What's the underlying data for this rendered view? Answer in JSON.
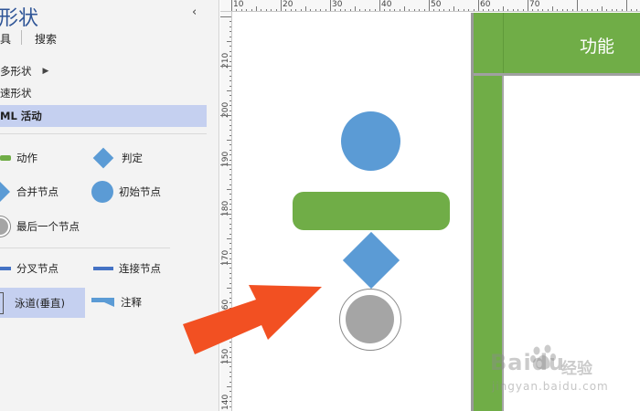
{
  "panel": {
    "title": "形状",
    "tabs": [
      "具",
      "搜索"
    ],
    "stencils": [
      {
        "label": "多形状",
        "has_submenu": true
      },
      {
        "label": "速形状",
        "has_submenu": false
      },
      {
        "label": "ML 活动",
        "active": true
      }
    ],
    "shapes": [
      {
        "label": "动作",
        "icon": "action-bar-icon",
        "color": "#70ad47"
      },
      {
        "label": "判定",
        "icon": "diamond-icon",
        "color": "#5b9bd5"
      },
      {
        "label": "合并节点",
        "icon": "merge-diamond-icon",
        "color": "#5b9bd5"
      },
      {
        "label": "初始节点",
        "icon": "circle-icon",
        "color": "#5b9bd5"
      },
      {
        "label": "最后一个节点",
        "icon": "final-node-icon",
        "color": "#a5a5a5"
      },
      {
        "label": "分叉节点",
        "icon": "fork-bar-icon",
        "color": "#4472c4"
      },
      {
        "label": "连接节点",
        "icon": "join-bar-icon",
        "color": "#4472c4"
      },
      {
        "label": "泳道(垂直)",
        "icon": "swimlane-icon",
        "selected": true
      },
      {
        "label": "注释",
        "icon": "note-icon",
        "color": "#5b9bd5"
      }
    ]
  },
  "rulers": {
    "top": [
      "10",
      "20",
      "30",
      "40",
      "50",
      "60",
      "70"
    ],
    "left": [
      "210",
      "200",
      "190",
      "180",
      "170",
      "160",
      "150",
      "140"
    ]
  },
  "swimlane": {
    "title": "功能",
    "color": "#70ad47"
  },
  "watermark": {
    "logo": "Baidu",
    "cn": "经验",
    "url": "jingyan.baidu.com"
  },
  "colors": {
    "accent_green": "#70ad47",
    "accent_blue": "#5b9bd5",
    "arrow": "#f25022",
    "final_gray": "#a5a5a5"
  }
}
